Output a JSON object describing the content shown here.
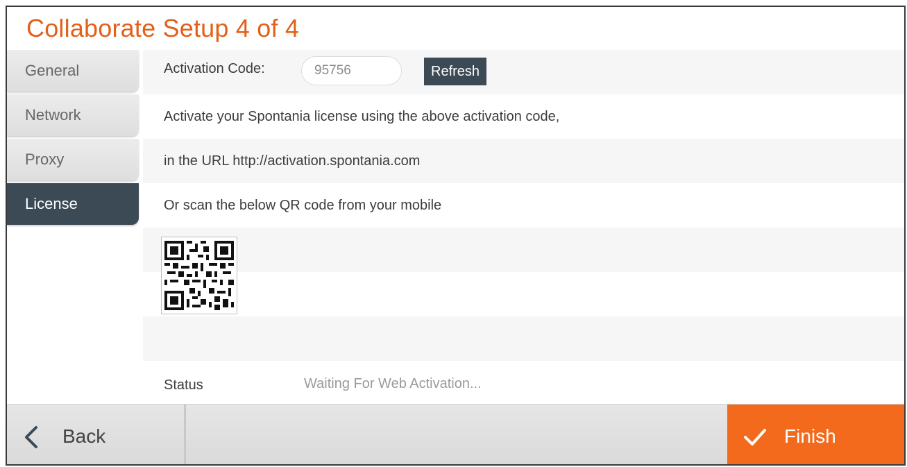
{
  "title": "Collaborate Setup 4 of 4",
  "sidebar": {
    "items": [
      {
        "label": "General",
        "active": false
      },
      {
        "label": "Network",
        "active": false
      },
      {
        "label": "Proxy",
        "active": false
      },
      {
        "label": "License",
        "active": true
      }
    ]
  },
  "license": {
    "activation_label": "Activation Code:",
    "activation_code": "95756",
    "refresh_label": "Refresh",
    "line1": "Activate your Spontania license using the above activation code,",
    "line2": "in the URL http://activation.spontania.com",
    "line3": "Or scan the below QR code from your mobile",
    "qr_icon": "qr-code",
    "status_label": "Status",
    "status_value": "Waiting For Web Activation..."
  },
  "footer": {
    "back_label": "Back",
    "back_icon": "chevron-left-icon",
    "finish_label": "Finish",
    "finish_icon": "checkmark-icon"
  },
  "colors": {
    "accent": "#e2601a",
    "finish_bg": "#f36a1d",
    "dark": "#3c4a56"
  }
}
